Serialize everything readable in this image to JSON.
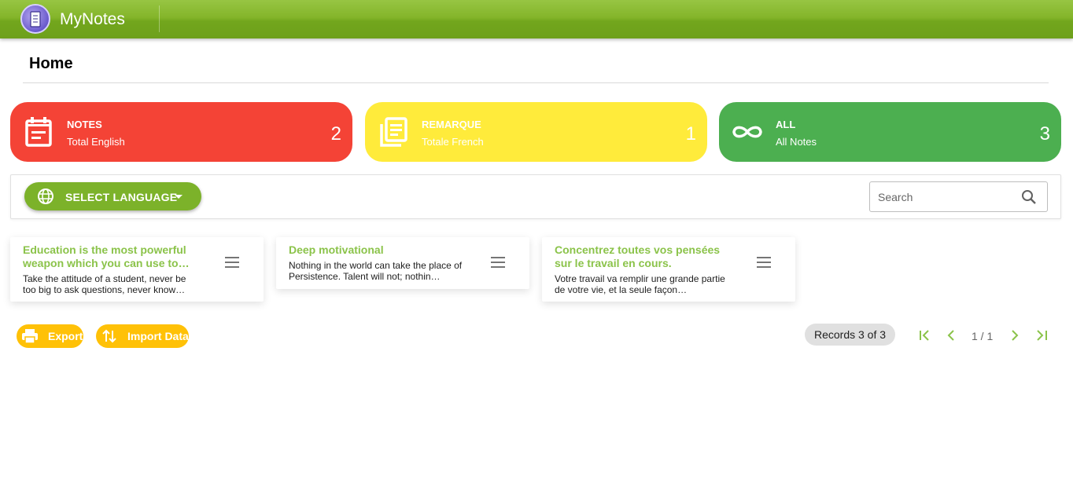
{
  "app": {
    "title": "MyNotes"
  },
  "page": {
    "title": "Home"
  },
  "stats": [
    {
      "label": "NOTES",
      "sub": "Total English",
      "count": "2",
      "color": "#f44336",
      "icon": "calendar-note-icon"
    },
    {
      "label": "REMARQUE",
      "sub": "Totale French",
      "count": "1",
      "color": "#ffeb3b",
      "icon": "library-books-icon"
    },
    {
      "label": "ALL",
      "sub": "All Notes",
      "count": "3",
      "color": "#4caf50",
      "icon": "infinity-icon"
    }
  ],
  "toolbar": {
    "language_label": "SELECT LANGUAGE",
    "search_placeholder": "Search"
  },
  "notes": [
    {
      "title": "Education is the most powerful weapon which you can use to…",
      "body": "Take the attitude of a student, never be too big to ask questions, never know…"
    },
    {
      "title": "Deep motivational",
      "body": "Nothing in the world can take the place of Persistence. Talent will not; nothin…"
    },
    {
      "title": "Concentrez toutes vos pensées sur le travail en cours.",
      "body": "Votre travail va remplir une grande partie de votre vie, et la seule façon…"
    }
  ],
  "actions": {
    "export_label": "Export",
    "import_label": "Import Data"
  },
  "pagination": {
    "records": "Records 3 of 3",
    "page": "1 / 1"
  },
  "colors": {
    "accent": "#7cb22a",
    "note_title": "#8bc34a",
    "action": "#ffc107"
  }
}
